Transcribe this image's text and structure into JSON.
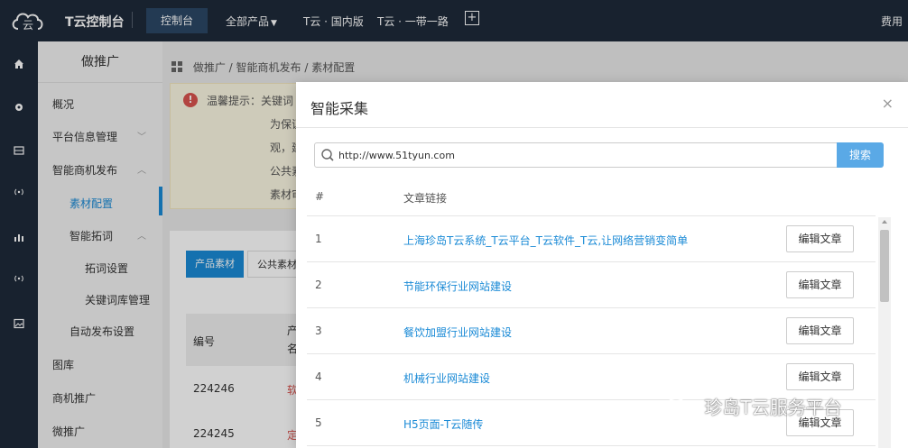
{
  "topbar": {
    "brand": "T云控制台",
    "console": "控制台",
    "nav": [
      "全部产品",
      "T云 · 国内版",
      "T云 · 一带一路"
    ],
    "nav_plus": "+",
    "right": "费用"
  },
  "rail": {
    "icons": [
      "home-icon",
      "gear-icon",
      "storage-icon",
      "signal-icon",
      "chart-icon",
      "signal-icon",
      "image-icon"
    ]
  },
  "sidebar": {
    "title": "做推广",
    "items": [
      "概况",
      "平台信息管理",
      "智能商机发布",
      "素材配置",
      "智能拓词",
      "拓词设置",
      "关键词库管理",
      "自动发布设置",
      "图库",
      "商机推广",
      "微推广"
    ]
  },
  "breadcrumb": [
    "做推广",
    "智能商机发布",
    "素材配置"
  ],
  "alert": {
    "lines": [
      "温馨提示：关键词",
      "为保证",
      "观，建",
      "公共素",
      "素材审"
    ]
  },
  "card": {
    "tabs": [
      "产品素材",
      "公共素材"
    ],
    "headers": [
      "编号",
      "产",
      "名"
    ],
    "rows": [
      {
        "id": "224246",
        "name": "软"
      },
      {
        "id": "224245",
        "name": "定"
      }
    ]
  },
  "modal": {
    "title": "智能采集",
    "close": "×",
    "search_value": "http://www.51tyun.com",
    "search_button": "搜索",
    "col_num": "#",
    "col_link": "文章链接",
    "rows": [
      {
        "num": "1",
        "link": "上海珍岛T云系统_T云平台_T云软件_T云,让网络营销变简单",
        "action": "编辑文章"
      },
      {
        "num": "2",
        "link": "节能环保行业网站建设",
        "action": "编辑文章"
      },
      {
        "num": "3",
        "link": "餐饮加盟行业网站建设",
        "action": "编辑文章"
      },
      {
        "num": "4",
        "link": "机械行业网站建设",
        "action": "编辑文章"
      },
      {
        "num": "5",
        "link": "H5页面-T云随传",
        "action": "编辑文章"
      }
    ]
  },
  "watermark": "珍岛T云服务平台",
  "colors": {
    "topbar": "#1e2a3a",
    "accent": "#1a8ad6",
    "search_button": "#5aa9e6"
  }
}
